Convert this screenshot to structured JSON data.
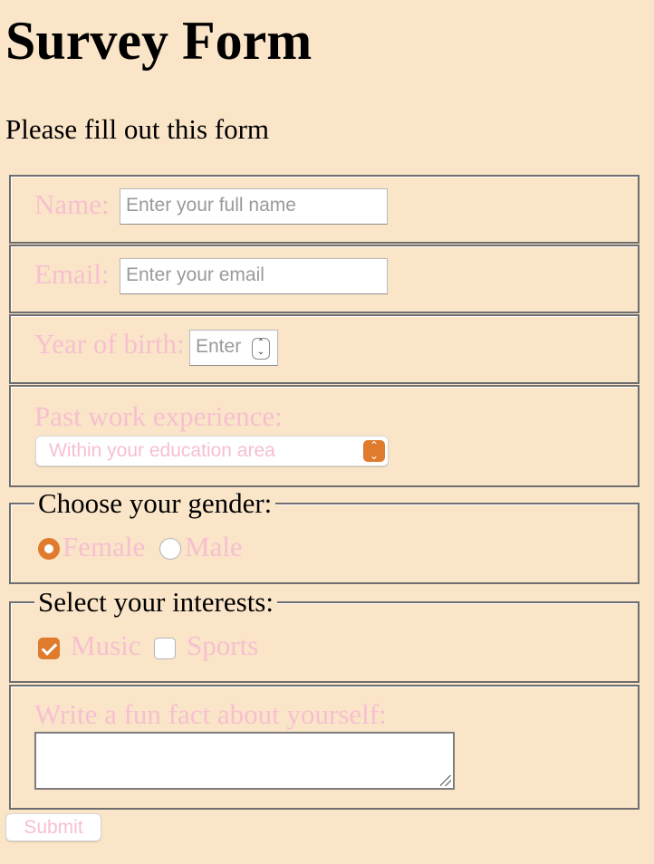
{
  "page": {
    "title": "Survey Form",
    "subtitle": "Please fill out this form"
  },
  "name_field": {
    "label": "Name:",
    "value": "",
    "placeholder": "Enter your full name"
  },
  "email_field": {
    "label": "Email:",
    "value": "",
    "placeholder": "Enter your email"
  },
  "birth_year_field": {
    "label": "Year of birth:",
    "value": "",
    "placeholder": "Enter"
  },
  "experience_field": {
    "label": "Past work experience:",
    "selected": "Within your education area",
    "icon": "chevron-updown-icon"
  },
  "gender_group": {
    "legend": "Choose your gender:",
    "options": [
      {
        "label": "Female",
        "checked": true
      },
      {
        "label": "Male",
        "checked": false
      }
    ]
  },
  "interests_group": {
    "legend": "Select your interests:",
    "options": [
      {
        "label": "Music",
        "checked": true
      },
      {
        "label": "Sports",
        "checked": false
      }
    ]
  },
  "fun_fact_field": {
    "label": "Write a fun fact about yourself:",
    "value": ""
  },
  "submit": {
    "label": "Submit"
  },
  "colors": {
    "background": "#fae5c8",
    "label_pink": "#f7bfd0",
    "accent_orange": "#e07a2c",
    "border_gray": "#6e6e6e"
  }
}
